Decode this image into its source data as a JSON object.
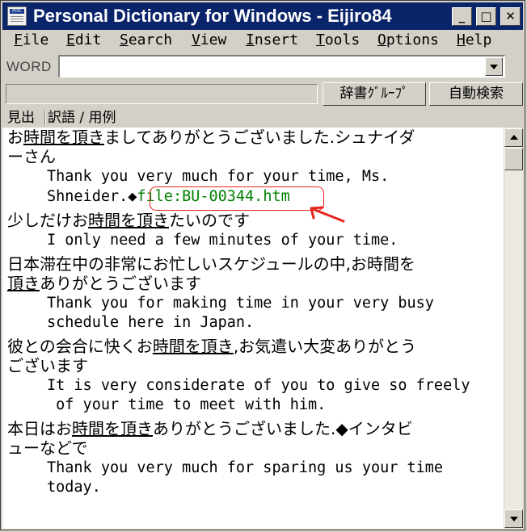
{
  "window": {
    "title": "Personal Dictionary for Windows - Eijiro84",
    "icon_label": "PDIC",
    "minimize_glyph": "_",
    "maximize_glyph": "□",
    "close_glyph": "✕"
  },
  "menu": [
    {
      "label": "File",
      "accel": "F",
      "rest": "ile"
    },
    {
      "label": "Edit",
      "accel": "E",
      "rest": "dit"
    },
    {
      "label": "Search",
      "accel": "S",
      "rest": "earch"
    },
    {
      "label": "View",
      "accel": "V",
      "rest": "iew"
    },
    {
      "label": "Insert",
      "accel": "I",
      "rest": "nsert"
    },
    {
      "label": "Tools",
      "accel": "T",
      "rest": "ools"
    },
    {
      "label": "Options",
      "accel": "O",
      "rest": "ptions"
    },
    {
      "label": "Help",
      "accel": "H",
      "rest": "elp"
    }
  ],
  "search": {
    "label": "WORD",
    "value": ""
  },
  "toolbar": {
    "group_button": "辞書ｸﾞﾙｰﾌﾟ",
    "auto_search_button": "自動検索"
  },
  "columns": {
    "headword": "見出",
    "translation": "訳語 / 用例"
  },
  "entries": [
    {
      "jp": [
        {
          "pre": "お",
          "hl": "時間を頂き",
          "post": "ましてありがとうございました.シュナイダ"
        },
        {
          "pre": "ーさん",
          "hl": "",
          "post": ""
        }
      ],
      "en": [
        "Thank you very much for your time, Ms."
      ],
      "en_last_prefix": "Shneider.◆",
      "link": "file:BU-00344.htm"
    },
    {
      "jp": [
        {
          "pre": "少しだけお",
          "hl": "時間を頂き",
          "post": "たいのです"
        }
      ],
      "en": [
        "I only need a few minutes of your time."
      ]
    },
    {
      "jp": [
        {
          "pre": "日本滞在中の非常にお忙しいスケジュールの中,お時間を",
          "hl": "",
          "post": ""
        },
        {
          "pre": "",
          "hl": "頂き",
          "post": "ありがとうございます"
        }
      ],
      "en": [
        "Thank you for making time in your very busy",
        "schedule here in Japan."
      ]
    },
    {
      "jp": [
        {
          "pre": "彼との会合に快くお",
          "hl": "時間を頂き",
          "post": ",お気遣い大変ありがとう"
        },
        {
          "pre": "ございます",
          "hl": "",
          "post": ""
        }
      ],
      "en": [
        "It is very considerate of you to give so freely",
        " of your time to meet with him."
      ]
    },
    {
      "jp": [
        {
          "pre": "本日はお",
          "hl": "時間を頂き",
          "post": "ありがとうございました.◆インタビ"
        },
        {
          "pre": "ューなどで",
          "hl": "",
          "post": ""
        }
      ],
      "en": [
        "Thank you very much for sparing us your time",
        "today."
      ]
    }
  ],
  "colors": {
    "title_bar": "#0a246a",
    "link": "#008000",
    "annotation": "#e8241e",
    "face": "#d4d0c8"
  }
}
